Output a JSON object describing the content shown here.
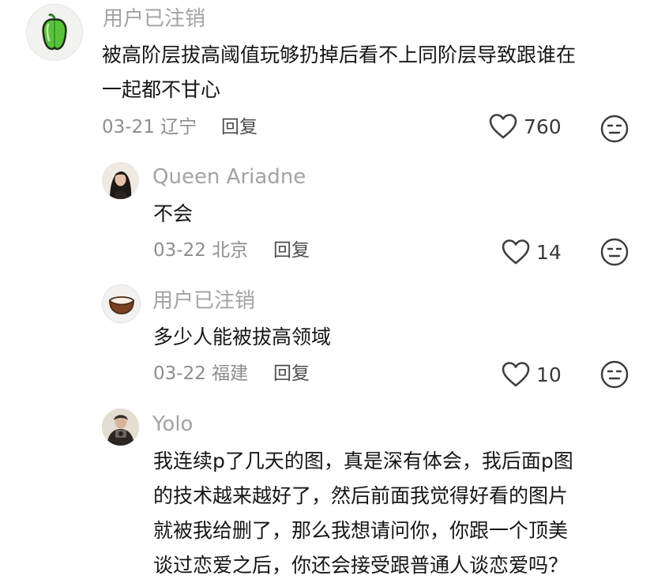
{
  "comments": [
    {
      "username": "用户已注销",
      "text_lines": [
        "被高阶层拔高阈值玩够扔掉后看不上同阶层导致跟谁在",
        "一起都不甘心"
      ],
      "date_location": "03-21 辽宁",
      "reply_label": "回复",
      "likes": "760",
      "avatar_icon": "green-pepper-icon"
    },
    {
      "username": "Queen Ariadne",
      "text_lines": [
        "不会"
      ],
      "date_location": "03-22 北京",
      "reply_label": "回复",
      "likes": "14",
      "avatar_icon": "user-photo"
    },
    {
      "username": "用户已注销",
      "text_lines": [
        "多少人能被拔高领域"
      ],
      "date_location": "03-22 福建",
      "reply_label": "回复",
      "likes": "10",
      "avatar_icon": "coconut-bowl-icon"
    },
    {
      "username": "Yolo",
      "text_lines": [
        "我连续p了几天的图，真是深有体会，我后面p图",
        "的技术越来越好了，然后前面我觉得好看的图片",
        "就被我给删了，那么我想请问你，你跟一个顶美",
        "谈过恋爱之后，你还会接受跟普通人谈恋爱吗？"
      ],
      "date_location": "",
      "reply_label": "",
      "likes": "",
      "avatar_icon": "user-photo"
    }
  ],
  "colors": {
    "username": "#a3a3a3",
    "text": "#161616",
    "meta": "#8e8e8e",
    "pepper": "#59c23a"
  }
}
